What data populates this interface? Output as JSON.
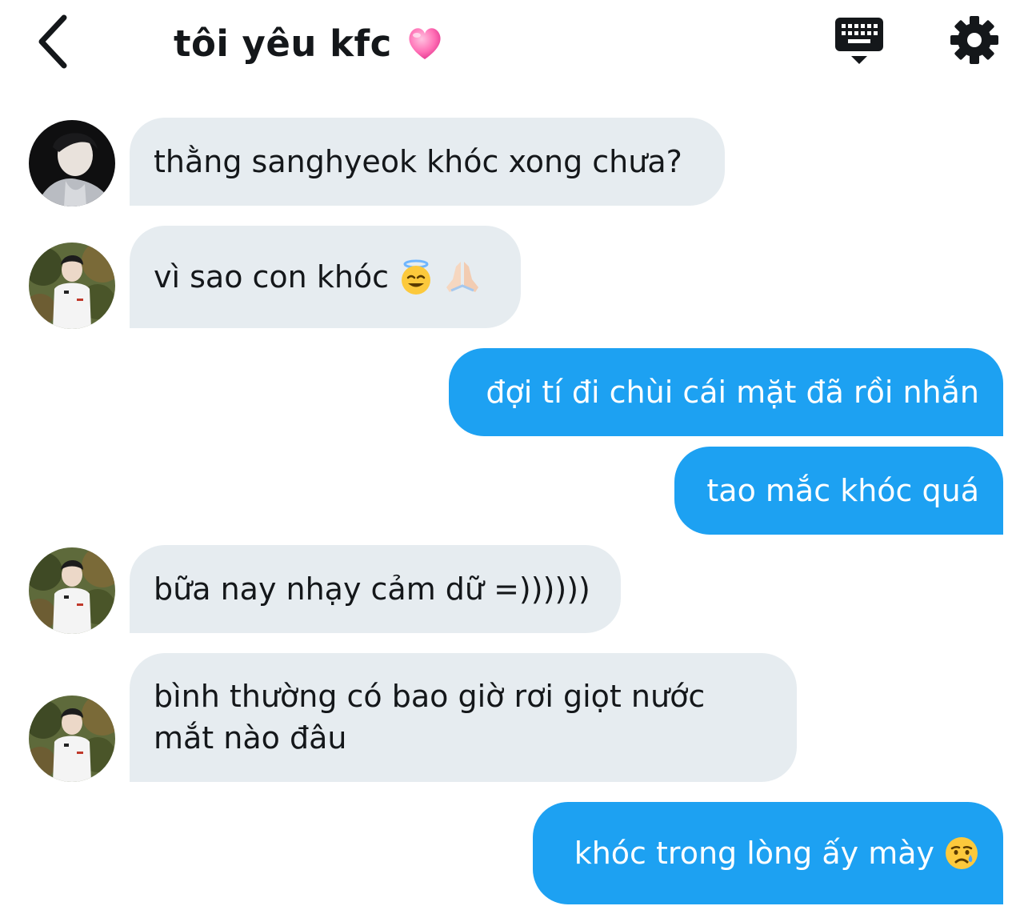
{
  "header": {
    "title": "tôi yêu kfc",
    "back_icon": "chevron-left-icon",
    "heart_icon": "pink-heart-icon",
    "keyboard_icon": "keyboard-icon",
    "settings_icon": "gear-icon"
  },
  "colors": {
    "incoming_bubble": "#e6ecf0",
    "outgoing_bubble": "#1da1f2",
    "text": "#14171a"
  },
  "messages": [
    {
      "direction": "incoming",
      "text": "thằng sanghyeok khóc xong chưa?",
      "avatar": "avatar-dark-portrait"
    },
    {
      "direction": "incoming",
      "text": "vì sao con khóc",
      "emoji": [
        "smiling-face-with-halo-icon",
        "folded-hands-icon"
      ],
      "avatar": "avatar-white-jacket"
    },
    {
      "direction": "outgoing",
      "text": "đợi tí đi chùi cái mặt đã rồi nhắn"
    },
    {
      "direction": "outgoing",
      "text": "tao mắc khóc quá"
    },
    {
      "direction": "incoming",
      "text": "bữa nay nhạy cảm dữ =))))))",
      "avatar": "avatar-white-jacket"
    },
    {
      "direction": "incoming",
      "text": "bình thường có bao giờ rơi giọt nước mắt nào đâu",
      "avatar": "avatar-white-jacket"
    },
    {
      "direction": "outgoing",
      "text": "khóc trong lòng ấy mày",
      "emoji": [
        "crying-face-icon"
      ]
    }
  ]
}
